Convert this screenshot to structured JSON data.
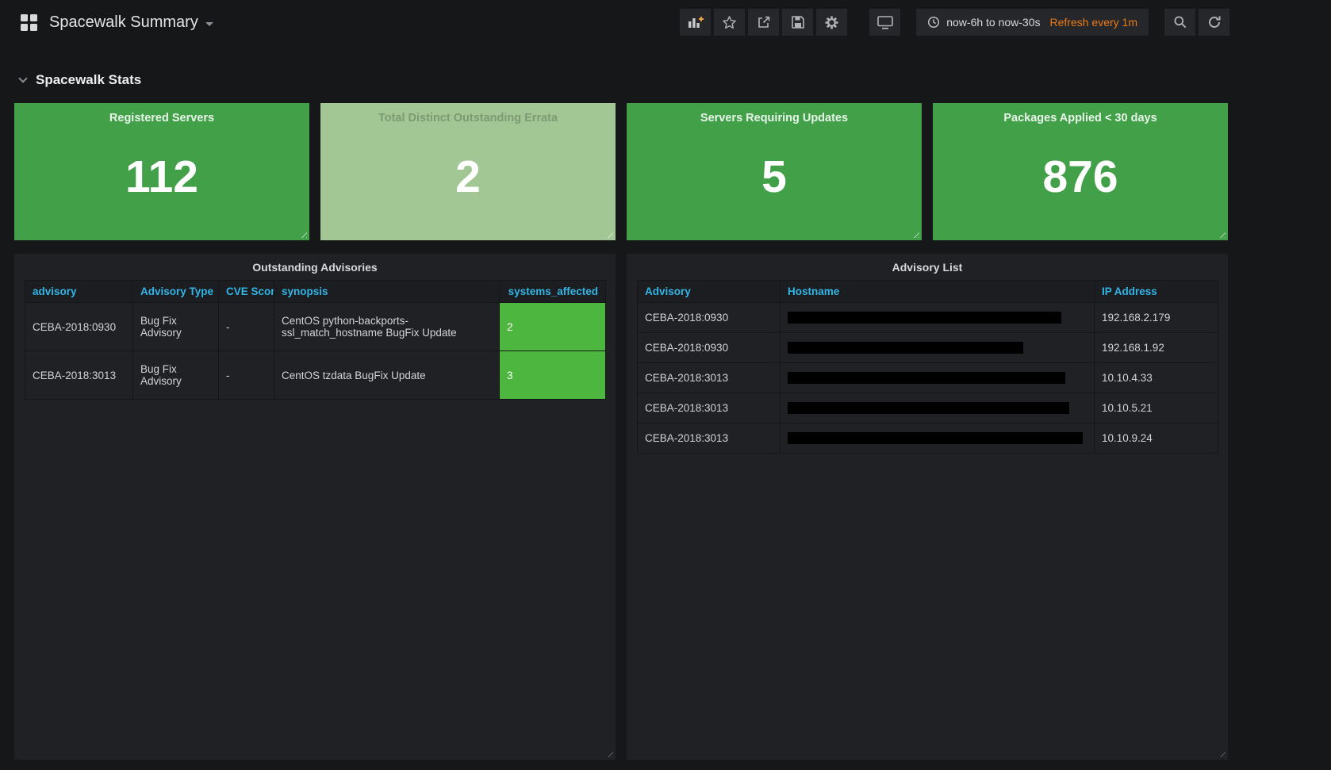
{
  "colors": {
    "page_bg": "#161719",
    "panel_bg": "#1f2124",
    "navbar_button_bg": "#25272a",
    "stat_green": "#42a049",
    "stat_green_pale": "#a2c795",
    "table_cell_green": "#4cb63e",
    "column_header_blue": "#33b5e5",
    "refresh_orange": "#eb7b18",
    "text_primary": "#d8d9da",
    "redaction_black": "#000000"
  },
  "navbar": {
    "title": "Spacewalk Summary",
    "buttons": {
      "add_panel": "bar-chart-plus-icon",
      "star": "star-icon",
      "share": "share-icon",
      "save": "floppy-disk-icon",
      "settings": "gear-icon",
      "tv_mode": "monitor-icon",
      "zoom_out": "magnifier-icon",
      "refresh": "circular-arrow-icon"
    },
    "time_picker": {
      "icon": "clock-icon",
      "range": "now-6h to now-30s",
      "refresh_interval": "Refresh every 1m"
    }
  },
  "row_header": {
    "title": "Spacewalk Stats"
  },
  "stat_panels": [
    {
      "title": "Registered Servers",
      "value": "112"
    },
    {
      "title": "Total Distinct Outstanding Errata",
      "value": "2"
    },
    {
      "title": "Servers Requiring Updates",
      "value": "5"
    },
    {
      "title": "Packages Applied < 30 days",
      "value": "876"
    }
  ],
  "outstanding_advisories": {
    "title": "Outstanding Advisories",
    "columns": {
      "advisory": "advisory",
      "type": "Advisory Type",
      "cve": "CVE Score",
      "synopsis": "synopsis",
      "affected": "systems_affected"
    },
    "rows": [
      {
        "advisory": "CEBA-2018:0930",
        "type": "Bug Fix Advisory",
        "cve": "-",
        "synopsis": "CentOS python-backports-ssl_match_hostname BugFix Update",
        "affected": "2"
      },
      {
        "advisory": "CEBA-2018:3013",
        "type": "Bug Fix Advisory",
        "cve": "-",
        "synopsis": "CentOS tzdata BugFix Update",
        "affected": "3"
      }
    ]
  },
  "advisory_list": {
    "title": "Advisory List",
    "columns": {
      "advisory": "Advisory",
      "hostname": "Hostname",
      "ip": "IP Address"
    },
    "rows": [
      {
        "advisory": "CEBA-2018:0930",
        "hostname_redacted": true,
        "ip": "192.168.2.179"
      },
      {
        "advisory": "CEBA-2018:0930",
        "hostname_redacted": true,
        "ip": "192.168.1.92"
      },
      {
        "advisory": "CEBA-2018:3013",
        "hostname_redacted": true,
        "ip": "10.10.4.33"
      },
      {
        "advisory": "CEBA-2018:3013",
        "hostname_redacted": true,
        "ip": "10.10.5.21"
      },
      {
        "advisory": "CEBA-2018:3013",
        "hostname_redacted": true,
        "ip": "10.10.9.24"
      }
    ]
  }
}
